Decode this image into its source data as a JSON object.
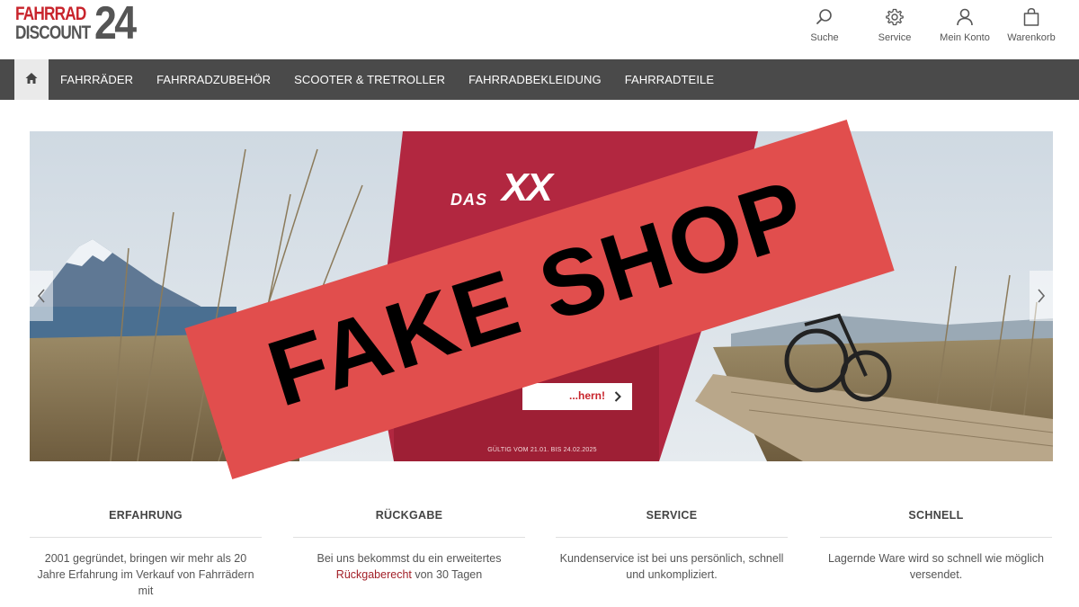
{
  "logo": {
    "line1": "FAHRRAD",
    "line2": "DISCOUNT",
    "number": "24"
  },
  "header_actions": [
    {
      "icon": "search-icon",
      "label": "Suche"
    },
    {
      "icon": "gear-icon",
      "label": "Service"
    },
    {
      "icon": "user-icon",
      "label": "Mein Konto"
    },
    {
      "icon": "shopping-bag-icon",
      "label": "Warenkorb"
    }
  ],
  "nav": {
    "home_icon": "home-icon",
    "items": [
      "FAHRRÄDER",
      "FAHRRADZUBEHÖR",
      "SCOOTER & TRETROLLER",
      "FAHRRADBEKLEIDUNG",
      "FAHRRADTEILE"
    ]
  },
  "hero": {
    "headline_das": "DAS",
    "headline_rest": "XX",
    "cta_label": "...hern!",
    "validity": "GÜLTIG VOM 21.01. BIS 24.02.2025",
    "prev_icon": "chevron-left-icon",
    "next_icon": "chevron-right-icon"
  },
  "stamp": {
    "text": "FAKE SHOP",
    "color": "#e14e4d"
  },
  "features": [
    {
      "title": "ERFAHRUNG",
      "text": "2001 gegründet, bringen wir mehr als 20 Jahre Erfahrung im Verkauf von Fahrrädern mit"
    },
    {
      "title": "RÜCKGABE",
      "text_before": "Bei uns bekommst du ein erweitertes",
      "link": "Rückgaberecht",
      "text_after": "von 30 Tagen"
    },
    {
      "title": "SERVICE",
      "text": "Kundenservice ist bei uns persönlich, schnell und unkompliziert."
    },
    {
      "title": "SCHNELL",
      "text": "Lagernde Ware wird so schnell wie möglich versendet."
    }
  ],
  "colors": {
    "brand_red": "#c8242c",
    "nav_bg": "#4a4a4a",
    "banner_red": "#b22740",
    "link_red": "#a21f27"
  }
}
